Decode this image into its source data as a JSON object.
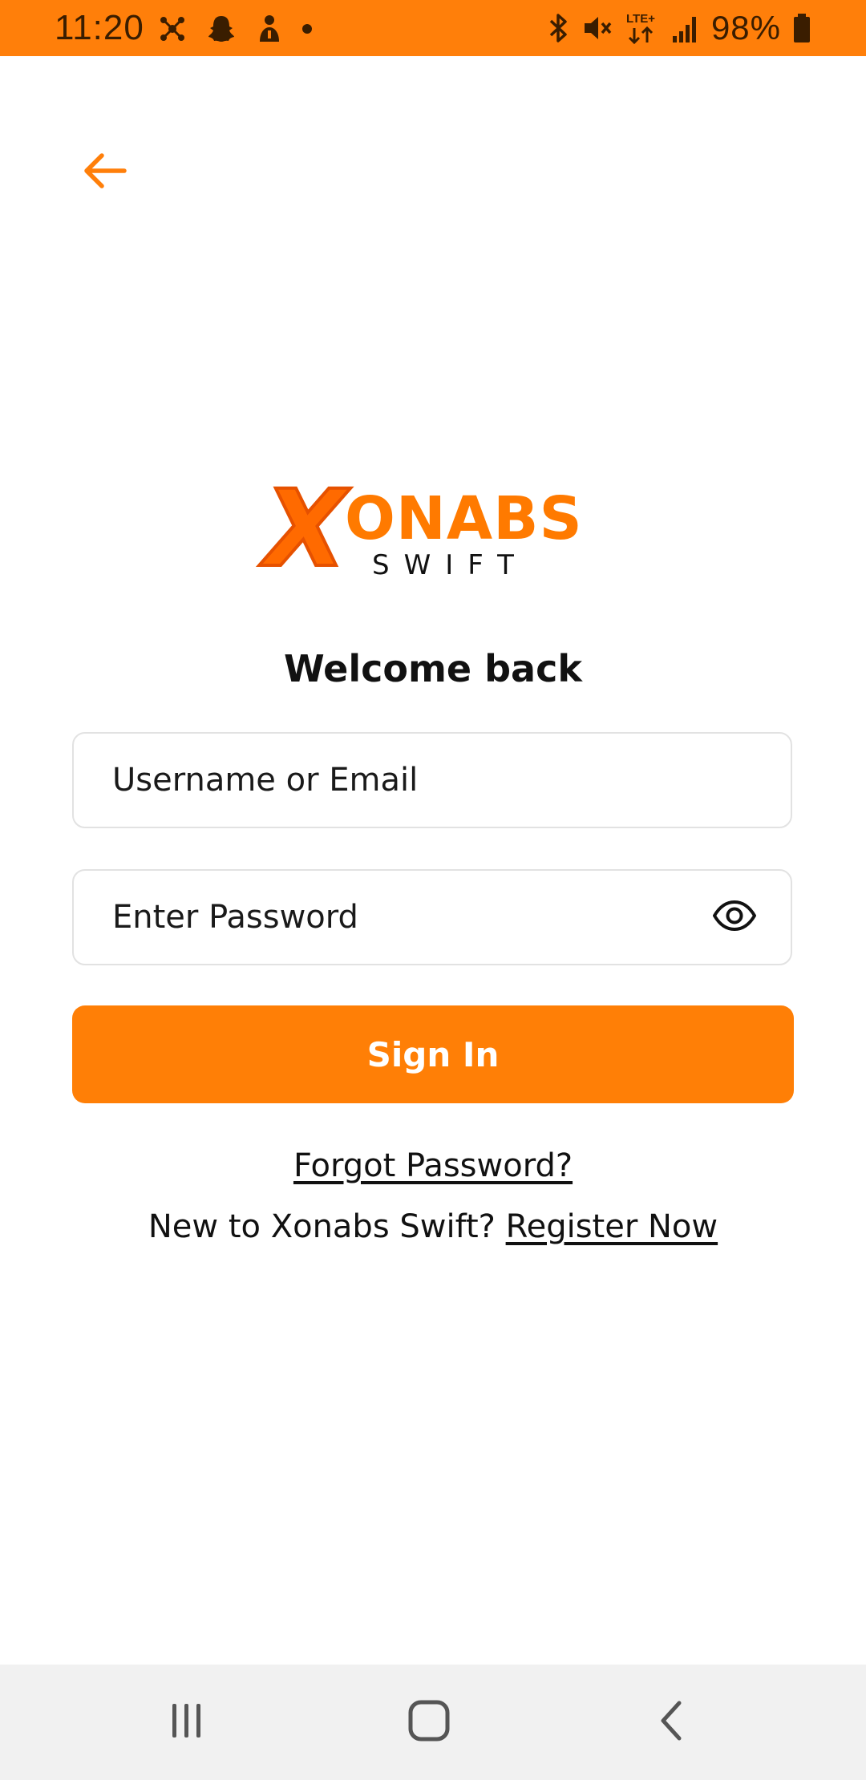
{
  "status_bar": {
    "time": "11:20",
    "battery_percent": "98%",
    "network_label": "LTE+",
    "left_icons": [
      "network-share-icon",
      "snapchat-icon",
      "notification-app-icon",
      "dot-icon"
    ],
    "right_icons": [
      "bluetooth-icon",
      "mute-icon",
      "lte-data-icon",
      "signal-icon",
      "battery-icon"
    ],
    "background_color": "#FF7F0A"
  },
  "header": {
    "back_icon": "arrow-left-icon",
    "accent_color": "#FF7F0A"
  },
  "logo": {
    "mark": "X",
    "word": "ONABS",
    "subtitle": "SWIFT"
  },
  "login": {
    "welcome_title": "Welcome back",
    "username_placeholder": "Username or Email",
    "username_value": "",
    "password_placeholder": "Enter Password",
    "password_value": "",
    "password_toggle_icon": "eye-icon",
    "sign_in_label": "Sign In",
    "forgot_password_label": "Forgot Password?",
    "register_prompt": "New to Xonabs Swift?",
    "register_label": "Register Now",
    "button_color": "#FF7F06"
  },
  "nav_bar": {
    "recents_icon": "recents-icon",
    "home_icon": "home-icon",
    "back_icon": "nav-back-icon"
  }
}
